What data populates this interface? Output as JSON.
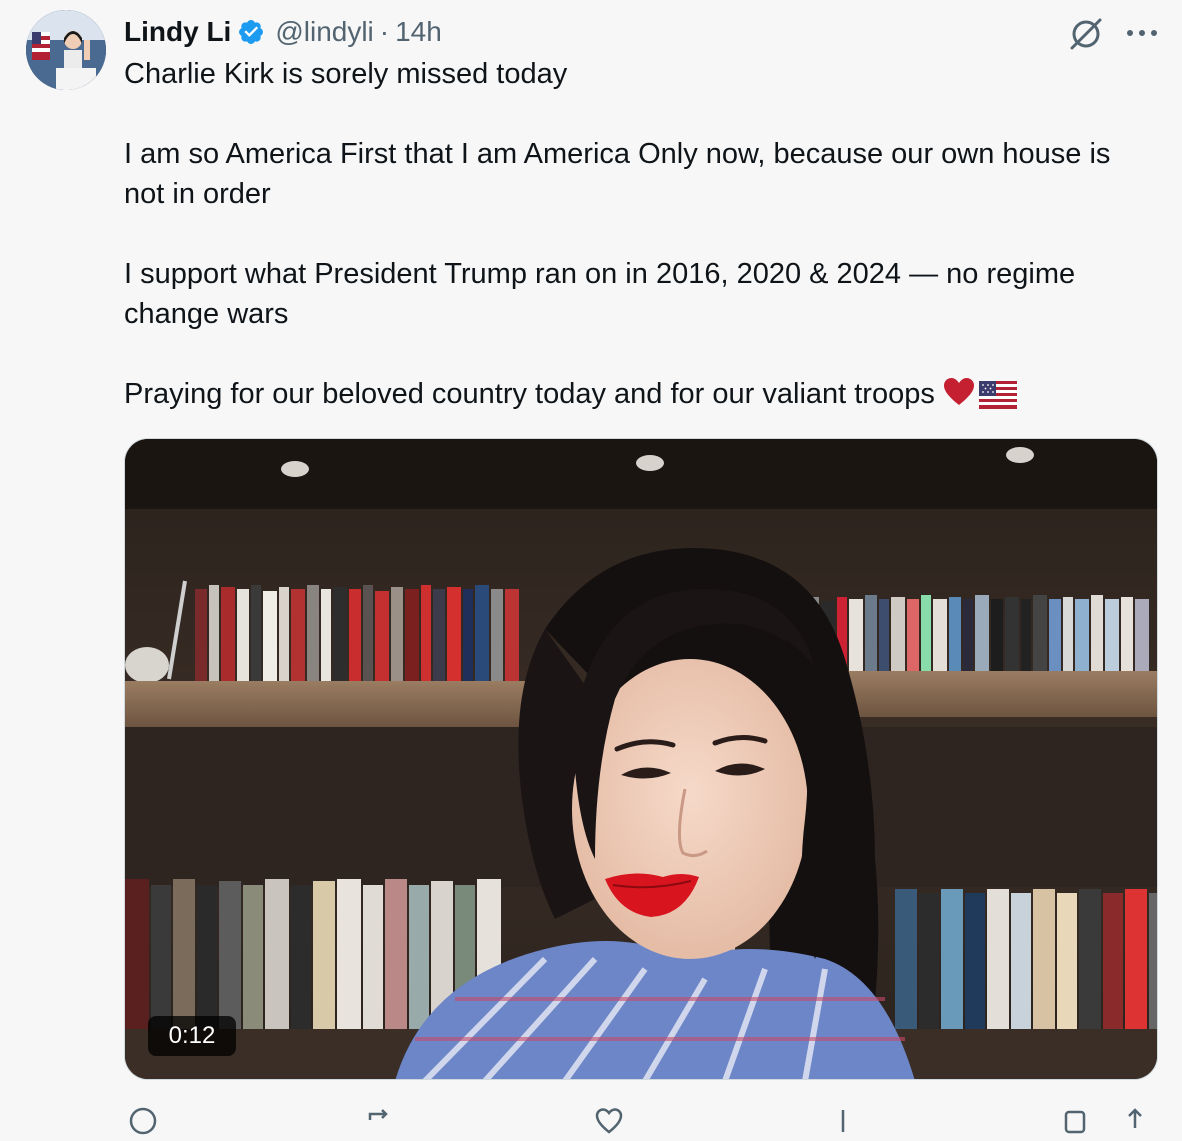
{
  "author": {
    "display_name": "Lindy Li",
    "handle": "@lindyli",
    "separator": "·",
    "time": "14h",
    "verified_color": "#1d9bf0"
  },
  "post": {
    "paragraphs": [
      "Charlie Kirk is sorely missed today",
      "I am so America First that I am America Only now, because our own house is not in order",
      "I support what President Trump ran on in 2016, 2020 & 2024 — no regime change wars",
      "Praying for our beloved country today and for our valiant troops"
    ],
    "trailing_emojis": [
      "red-heart",
      "us-flag"
    ]
  },
  "media": {
    "type": "video",
    "duration": "0:12"
  },
  "icons": {
    "grok": "grok-slash-circle-icon",
    "more": "more-dots-icon"
  },
  "colors": {
    "text": "#0f1419",
    "secondary": "#536471",
    "background": "#f7f7f7",
    "heart": "#c42032"
  }
}
